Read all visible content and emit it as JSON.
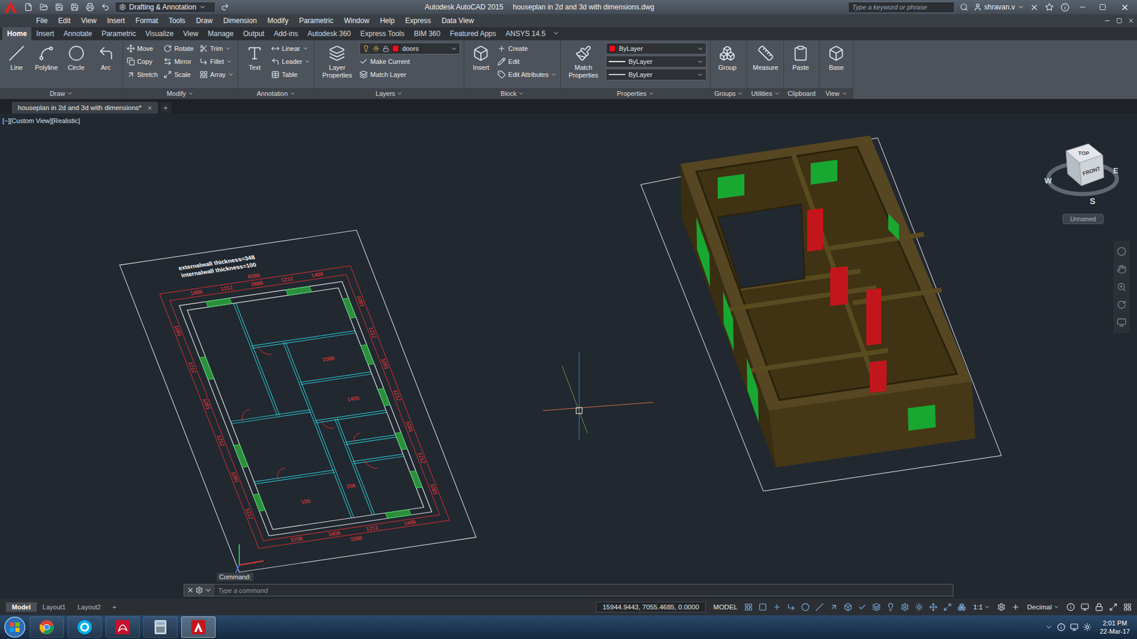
{
  "window": {
    "title": "Autodesk AutoCAD 2015",
    "document": "houseplan in 2d and 3d with dimensions.dwg"
  },
  "workspace": "Drafting & Annotation",
  "search": {
    "placeholder": "Type a keyword or phrase"
  },
  "user": "shravan.v",
  "menu": [
    "File",
    "Edit",
    "View",
    "Insert",
    "Format",
    "Tools",
    "Draw",
    "Dimension",
    "Modify",
    "Parametric",
    "Window",
    "Help",
    "Express",
    "Data View"
  ],
  "ribbon_tabs": [
    {
      "label": "Home",
      "selected": true
    },
    {
      "label": "Insert",
      "selected": false
    },
    {
      "label": "Annotate",
      "selected": false
    },
    {
      "label": "Parametric",
      "selected": false
    },
    {
      "label": "Visualize",
      "selected": false
    },
    {
      "label": "View",
      "selected": false
    },
    {
      "label": "Manage",
      "selected": false
    },
    {
      "label": "Output",
      "selected": false
    },
    {
      "label": "Add-ins",
      "selected": false
    },
    {
      "label": "Autodesk 360",
      "selected": false
    },
    {
      "label": "Express Tools",
      "selected": false
    },
    {
      "label": "BIM 360",
      "selected": false
    },
    {
      "label": "Featured Apps",
      "selected": false
    },
    {
      "label": "ANSYS 14.5",
      "selected": false
    }
  ],
  "ribbon_panels": [
    {
      "title": "Draw",
      "menu": true,
      "large": [
        "Line",
        "Polyline",
        "Circle",
        "Arc"
      ],
      "small": [],
      "fields": []
    },
    {
      "title": "Modify",
      "menu": true,
      "large": [],
      "small": [
        {
          "label": "Move",
          "dropdown": false
        },
        {
          "label": "Copy",
          "dropdown": false
        },
        {
          "label": "Stretch",
          "dropdown": false
        },
        {
          "label": "Rotate",
          "dropdown": false
        },
        {
          "label": "Mirror",
          "dropdown": false
        },
        {
          "label": "Scale",
          "dropdown": false
        },
        {
          "label": "Trim",
          "dropdown": true
        },
        {
          "label": "Fillet",
          "dropdown": true
        },
        {
          "label": "Array",
          "dropdown": true
        }
      ],
      "fields": []
    },
    {
      "title": "Annotation",
      "menu": true,
      "large": [
        "Text"
      ],
      "small": [
        {
          "label": "Linear",
          "dropdown": true
        },
        {
          "label": "Leader",
          "dropdown": true
        },
        {
          "label": "Table",
          "dropdown": false
        }
      ],
      "fields": []
    },
    {
      "title": "Layers",
      "menu": true,
      "large": [
        "Layer Properties"
      ],
      "small": [
        {
          "label": "Make Current",
          "dropdown": false
        },
        {
          "label": "Match Layer",
          "dropdown": false
        }
      ],
      "fields": [
        {
          "value": "doors",
          "kind": "layer",
          "swatch": "#e8141b"
        }
      ]
    },
    {
      "title": "Block",
      "menu": true,
      "large": [
        "Insert"
      ],
      "small": [
        {
          "label": "Create",
          "dropdown": false
        },
        {
          "label": "Edit",
          "dropdown": false
        },
        {
          "label": "Edit Attributes",
          "dropdown": true
        }
      ],
      "fields": []
    },
    {
      "title": "Properties",
      "menu": true,
      "large": [
        "Match Properties"
      ],
      "small": [],
      "fields": [
        {
          "value": "ByLayer",
          "kind": "color",
          "swatch": "#e8141b"
        },
        {
          "value": "ByLayer",
          "kind": "line",
          "swatch": "#ffffff"
        },
        {
          "value": "ByLayer",
          "kind": "line",
          "swatch": "#cfcfcf"
        }
      ]
    },
    {
      "title": "Groups",
      "menu": true,
      "large": [
        "Group"
      ],
      "small": [],
      "fields": []
    },
    {
      "title": "Utilities",
      "menu": true,
      "large": [
        "Measure"
      ],
      "small": [],
      "fields": []
    },
    {
      "title": "Clipboard",
      "menu": false,
      "large": [
        "Paste"
      ],
      "small": [],
      "fields": []
    },
    {
      "title": "View",
      "menu": true,
      "large": [
        "Base"
      ],
      "small": [],
      "fields": []
    }
  ],
  "file_tabs": {
    "tabs": [
      {
        "label": "houseplan in 2d and 3d with dimensions*",
        "selected": true,
        "close": "×"
      }
    ],
    "add": "+"
  },
  "viewport": {
    "controls": [
      "[−]",
      "[Custom View]",
      "[Realistic]"
    ]
  },
  "plan": {
    "notes": [
      "externalwall thickness=348",
      "internalwall thickness=100"
    ],
    "top": [
      "1488",
      "1212",
      "2888",
      "1212",
      "1488"
    ],
    "top_outer": [
      "6088"
    ],
    "left": [
      "1091",
      "1212",
      "1091",
      "1212",
      "1091",
      "1212"
    ],
    "right": [
      "1091",
      "1212",
      "1091",
      "1212",
      "1091",
      "1212",
      "1091"
    ],
    "bottom": [
      "3708",
      "3408",
      "1212",
      "1488"
    ],
    "bottom_outer": [
      "3388"
    ],
    "interior": [
      "2088",
      "1400",
      "100",
      "208"
    ]
  },
  "viewcube": {
    "top": "TOP",
    "front": "FRONT",
    "west": "W",
    "east": "E",
    "south": "S",
    "ucs": "Unnamed"
  },
  "command": {
    "history": "Command:",
    "placeholder": "Type a command"
  },
  "layout_tabs": {
    "tabs": [
      {
        "label": "Model",
        "selected": true
      },
      {
        "label": "Layout1",
        "selected": false
      },
      {
        "label": "Layout2",
        "selected": false
      }
    ],
    "add": "+"
  },
  "status": {
    "coordinates": "15944.9443, 7055.4685, 0.0000",
    "space": "MODEL",
    "scale": "1:1",
    "units": "Decimal"
  },
  "taskbar": {
    "apps": [
      {
        "kind": "chrome",
        "active": false
      },
      {
        "kind": "skype",
        "active": false
      },
      {
        "kind": "acrobat",
        "active": false
      },
      {
        "kind": "calculator",
        "active": false
      },
      {
        "kind": "autocad",
        "active": true
      }
    ],
    "time": "2:01 PM",
    "date": "22-Mar-17"
  }
}
